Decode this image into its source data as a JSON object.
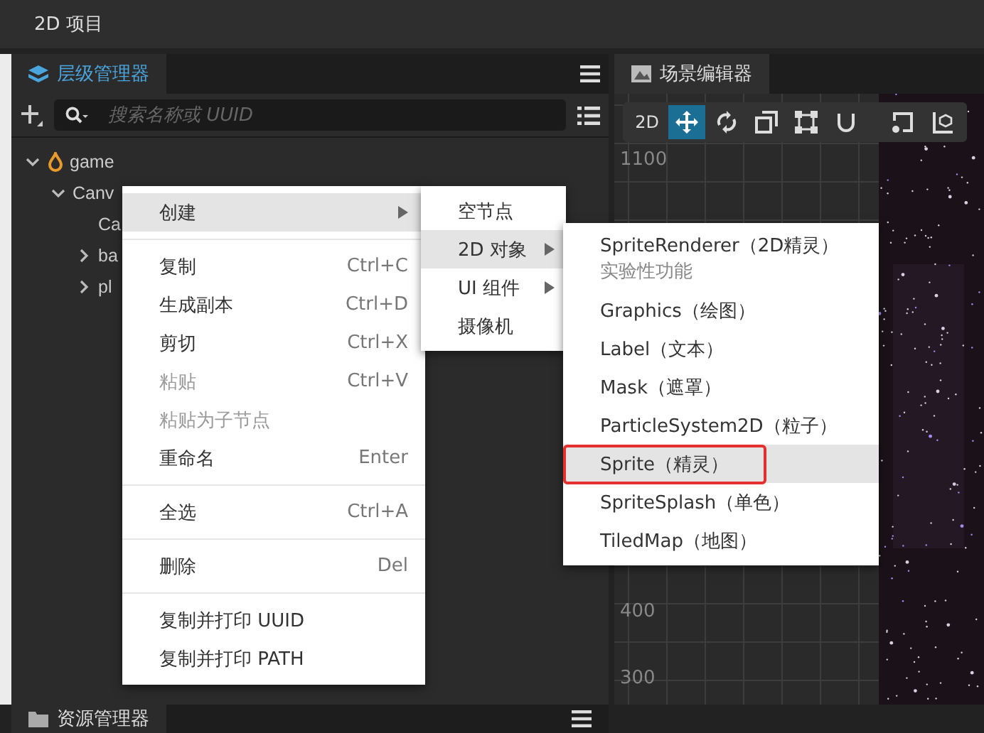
{
  "window": {
    "title": "2D 项目"
  },
  "hierarchy": {
    "tab": {
      "label": "层级管理器",
      "selected": true
    },
    "search": {
      "placeholder": "搜索名称或 UUID"
    },
    "tree": [
      {
        "name": "game",
        "expanded": true,
        "children": [
          {
            "name": "Canv",
            "expanded": true,
            "children": [
              {
                "name": "Ca"
              },
              {
                "name": "ba",
                "expanded": false
              },
              {
                "name": "pl",
                "expanded": false
              }
            ]
          }
        ]
      }
    ]
  },
  "scene": {
    "tab": {
      "label": "场景编辑器",
      "selected": false
    },
    "tools": [
      {
        "kind": "text",
        "label": "2D",
        "selected": false
      },
      {
        "kind": "move",
        "selected": true
      },
      {
        "kind": "rotate",
        "selected": false
      },
      {
        "kind": "scale",
        "selected": false
      },
      {
        "kind": "rect",
        "selected": false
      },
      {
        "kind": "magnet",
        "selected": false
      },
      {
        "kind": "gap"
      },
      {
        "kind": "pivot",
        "selected": false
      },
      {
        "kind": "cube",
        "selected": false
      }
    ],
    "ruler_labels": [
      {
        "label": "1100"
      },
      {
        "label": "400"
      },
      {
        "label": "300"
      }
    ]
  },
  "assets": {
    "tab": {
      "label": "资源管理器",
      "selected": false
    }
  },
  "context_menu": [
    {
      "kind": "item",
      "label": "创建",
      "submenu": true,
      "selected": true,
      "disabled": false
    },
    {
      "kind": "separator"
    },
    {
      "kind": "item",
      "label": "复制",
      "shortcut": "Ctrl+C",
      "selected": false,
      "disabled": false
    },
    {
      "kind": "item",
      "label": "生成副本",
      "shortcut": "Ctrl+D",
      "selected": false,
      "disabled": false
    },
    {
      "kind": "item",
      "label": "剪切",
      "shortcut": "Ctrl+X",
      "selected": false,
      "disabled": false
    },
    {
      "kind": "item",
      "label": "粘贴",
      "shortcut": "Ctrl+V",
      "selected": false,
      "disabled": true
    },
    {
      "kind": "item",
      "label": "粘贴为子节点",
      "selected": false,
      "disabled": true
    },
    {
      "kind": "item",
      "label": "重命名",
      "shortcut": "Enter",
      "selected": false,
      "disabled": false
    },
    {
      "kind": "separator"
    },
    {
      "kind": "item",
      "label": "全选",
      "shortcut": "Ctrl+A",
      "selected": false,
      "disabled": false
    },
    {
      "kind": "separator"
    },
    {
      "kind": "item",
      "label": "删除",
      "shortcut": "Del",
      "selected": false,
      "disabled": false
    },
    {
      "kind": "separator"
    },
    {
      "kind": "item",
      "label": "复制并打印 UUID",
      "selected": false,
      "disabled": false
    },
    {
      "kind": "item",
      "label": "复制并打印 PATH",
      "selected": false,
      "disabled": false
    }
  ],
  "create_submenu": [
    {
      "label": "空节点",
      "submenu": false,
      "selected": false
    },
    {
      "label": "2D 对象",
      "submenu": true,
      "selected": true
    },
    {
      "label": "UI 组件",
      "submenu": true,
      "selected": false
    },
    {
      "label": "摄像机",
      "submenu": false,
      "selected": false
    }
  ],
  "object_submenu": [
    {
      "label": "SpriteRenderer（2D精灵）",
      "note": "实验性功能",
      "selected": false,
      "outlined": false
    },
    {
      "label": "Graphics（绘图）",
      "selected": false,
      "outlined": false
    },
    {
      "label": "Label（文本）",
      "selected": false,
      "outlined": false
    },
    {
      "label": "Mask（遮罩）",
      "selected": false,
      "outlined": false
    },
    {
      "label": "ParticleSystem2D（粒子）",
      "selected": false,
      "outlined": false
    },
    {
      "label": "Sprite（精灵）",
      "selected": true,
      "outlined": true
    },
    {
      "label": "SpriteSplash（单色）",
      "selected": false,
      "outlined": false
    },
    {
      "label": "TiledMap（地图）",
      "selected": false,
      "outlined": false
    }
  ]
}
